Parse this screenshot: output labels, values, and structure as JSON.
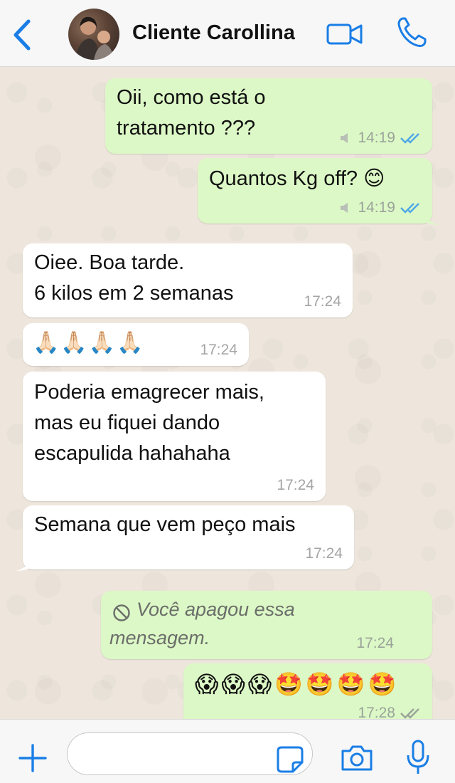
{
  "header": {
    "contact_name": "Cliente Carollina",
    "icons": [
      "chevron-left-icon",
      "video-call-icon",
      "phone-icon"
    ]
  },
  "messages": [
    {
      "direction": "out",
      "text": "Oii, como está o\ntratamento ???",
      "time": "14:19",
      "status": "read"
    },
    {
      "direction": "out",
      "text": "Quantos Kg off? 😊",
      "time": "14:19",
      "status": "read"
    },
    {
      "direction": "in",
      "text": "Oiee. Boa tarde.\n6 kilos em 2 semanas",
      "time": "17:24"
    },
    {
      "direction": "in",
      "text": "🙏🏻🙏🏻🙏🏻🙏🏻",
      "time": "17:24"
    },
    {
      "direction": "in",
      "text": "Poderia emagrecer mais,\nmas eu fiquei dando\nescapulida hahahaha",
      "time": "17:24"
    },
    {
      "direction": "in",
      "text": "Semana que vem peço mais",
      "time": "17:24"
    },
    {
      "direction": "out",
      "text": "Você apagou essa\nmensagem.",
      "time": "17:24",
      "deleted": true
    },
    {
      "direction": "out",
      "text": "😱😱😱🤩🤩🤩🤩",
      "time": "17:28",
      "status": "delivered"
    }
  ],
  "footer": {
    "input_placeholder": "",
    "icons": [
      "plus-icon",
      "sticker-icon",
      "camera-icon",
      "microphone-icon"
    ]
  },
  "colors": {
    "outgoing_bubble": "#dcf8c6",
    "incoming_bubble": "#ffffff",
    "accent": "#1a7ee6",
    "read_tick": "#4fa8e8"
  }
}
